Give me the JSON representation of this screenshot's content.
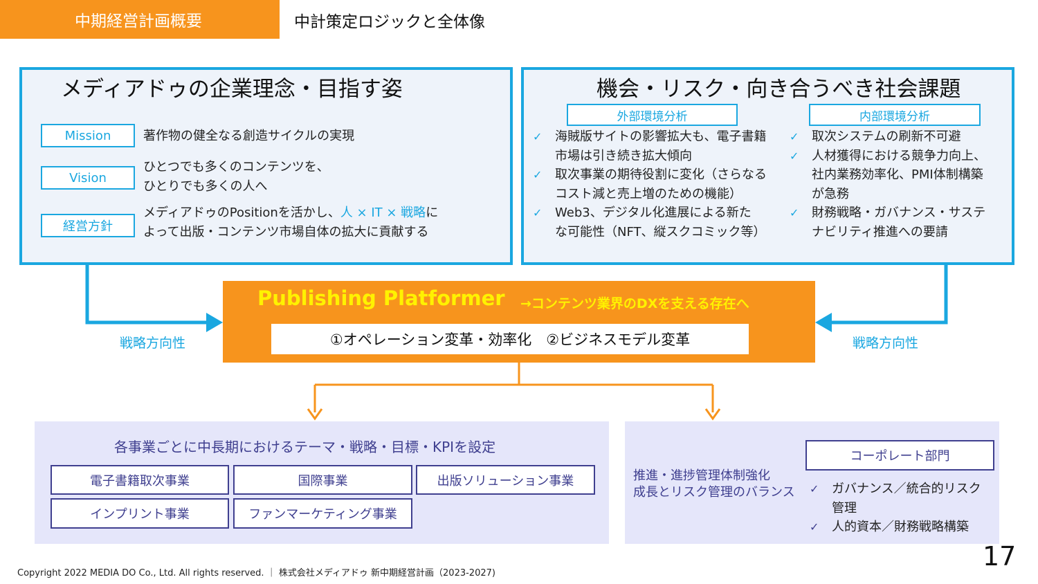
{
  "header": {
    "tag": "中期経営計画概要",
    "subtitle": "中計策定ロジックと全体像"
  },
  "left_panel": {
    "heading": "メディアドゥの企業理念・目指す姿",
    "mission": {
      "label": "Mission",
      "text": "著作物の健全なる創造サイクルの実現"
    },
    "vision": {
      "label": "Vision",
      "line1": "ひとつでも多くのコンテンツを、",
      "line2": "ひとりでも多くの人へ"
    },
    "policy": {
      "label": "経営方針",
      "line1_pre": "メディアドゥのPositionを活かし、",
      "line1_hl": "人 × IT × 戦略",
      "line1_post": "に",
      "line2": "よって出版・コンテンツ市場自体の拡大に貢献する"
    }
  },
  "right_panel": {
    "heading": "機会・リスク・向き合うべき社会課題",
    "external": {
      "label": "外部環境分析",
      "items": [
        {
          "l1": "海賊版サイトの影響拡大も、電子書籍",
          "l2": "市場は引き続き拡大傾向"
        },
        {
          "l1": "取次事業の期待役割に変化（さらなる",
          "l2": "コスト減と売上増のための機能）"
        },
        {
          "l1": "Web3、デジタル化進展による新た",
          "l2": "な可能性（NFT、縦スクコミック等）"
        }
      ]
    },
    "internal": {
      "label": "内部環境分析",
      "items": [
        {
          "l1": "取次システムの刷新不可避",
          "l2": ""
        },
        {
          "l1": "人材獲得における競争力向上、",
          "l2": "社内業務効率化、PMI体制構築",
          "l3": "が急務"
        },
        {
          "l1": "財務戦略・ガバナンス・サステ",
          "l2": "ナビリティ推進への要請"
        }
      ]
    }
  },
  "platform": {
    "title": "Publishing Platformer",
    "subtitle": "→コンテンツ業界のDXを支える存在へ",
    "bar": "①オペレーション変革・効率化　②ビジネスモデル変革",
    "left_dir": "戦略方向性",
    "right_dir": "戦略方向性"
  },
  "bottom_left": {
    "heading": "各事業ごとに中長期におけるテーマ・戦略・目標・KPIを設定",
    "businesses": [
      "電子書籍取次事業",
      "国際事業",
      "出版ソリューション事業",
      "インプリント事業",
      "ファンマーケティング事業"
    ]
  },
  "bottom_right": {
    "line1": "推進・進捗管理体制強化",
    "line2": "成長とリスク管理のバランス",
    "dept": "コーポレート部門",
    "items": [
      {
        "l1": "ガバナンス／統合的リスク",
        "l2": "管理"
      },
      {
        "l1": "人的資本／財務戦略構築",
        "l2": ""
      }
    ]
  },
  "footer": {
    "copyright": "Copyright 2022 MEDIA DO Co., Ltd. All rights reserved. ｜ 株式会社メディアドゥ 新中期経営計画（2023-2027)",
    "page": "17"
  },
  "colors": {
    "orange": "#f7941d",
    "blue": "#1aa7e0",
    "yellow": "#fff200",
    "purple": "#3f3f8f",
    "lavender": "#e5e6fa"
  },
  "icons": {
    "check": "check-icon",
    "arrow": "arrow-icon"
  }
}
